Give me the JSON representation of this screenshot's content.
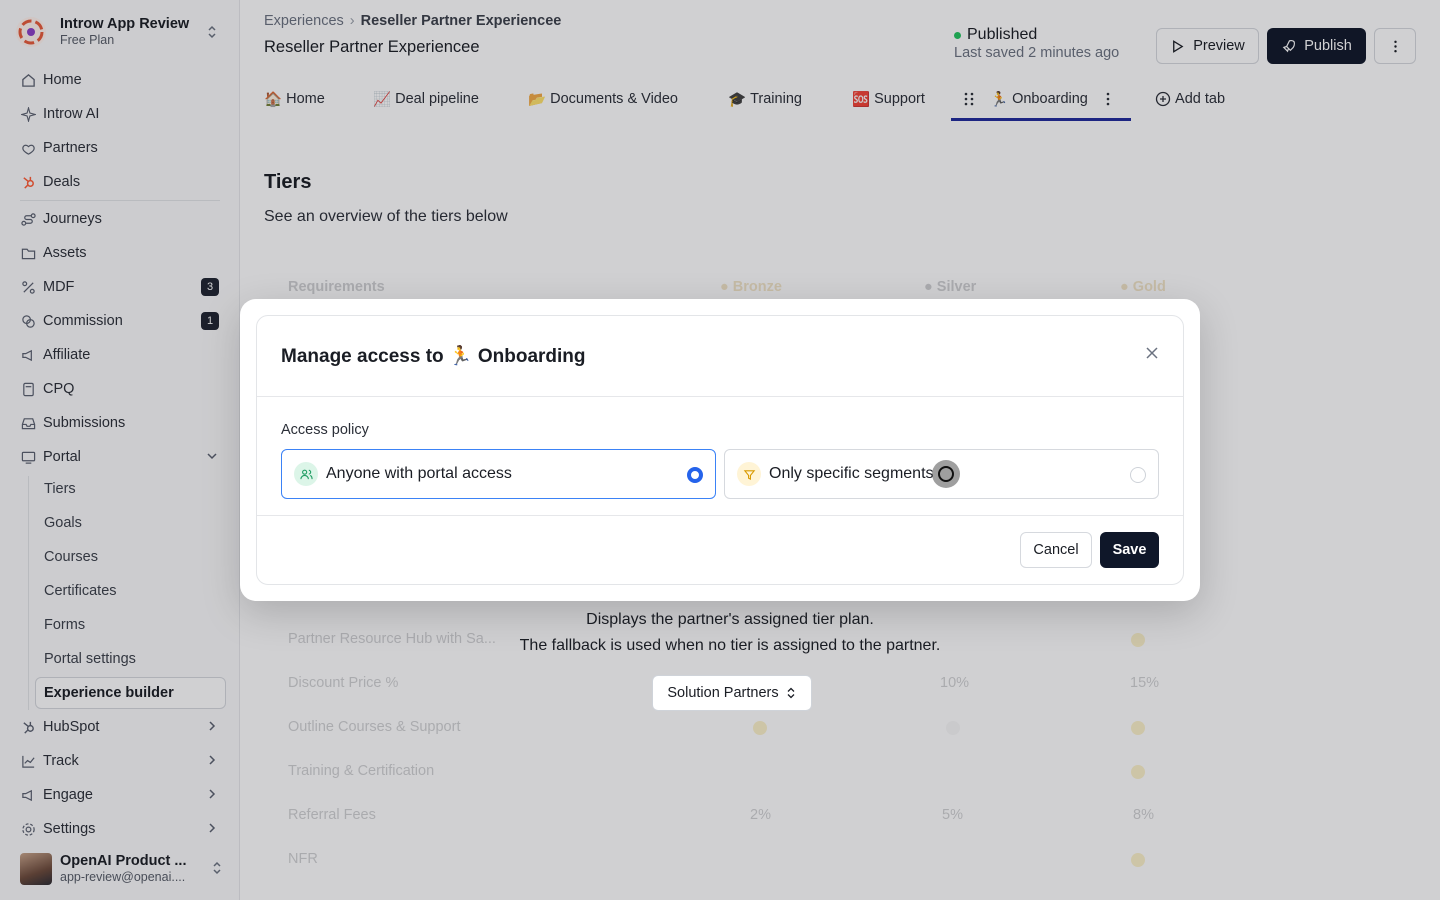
{
  "workspace": {
    "name": "Introw App Review",
    "plan": "Free Plan"
  },
  "sidebar": {
    "items": [
      {
        "label": "Home",
        "icon": "home-icon"
      },
      {
        "label": "Introw AI",
        "icon": "sparkle-icon"
      },
      {
        "label": "Partners",
        "icon": "handshake-icon"
      },
      {
        "label": "Deals",
        "icon": "hubspot-icon"
      },
      {
        "label": "Journeys",
        "icon": "route-icon"
      },
      {
        "label": "Assets",
        "icon": "folder-icon"
      },
      {
        "label": "MDF",
        "icon": "percent-icon",
        "badge": "3"
      },
      {
        "label": "Commission",
        "icon": "coins-icon",
        "badge": "1"
      },
      {
        "label": "Affiliate",
        "icon": "megaphone-icon"
      },
      {
        "label": "CPQ",
        "icon": "calculator-icon"
      },
      {
        "label": "Submissions",
        "icon": "inbox-icon"
      },
      {
        "label": "Portal",
        "icon": "monitor-icon"
      }
    ],
    "portal_sub": [
      "Tiers",
      "Goals",
      "Courses",
      "Certificates",
      "Forms",
      "Portal settings"
    ],
    "portal_active": "Experience builder",
    "bottom_items": [
      {
        "label": "HubSpot",
        "icon": "hubspot-icon"
      },
      {
        "label": "Track",
        "icon": "chart-icon"
      },
      {
        "label": "Engage",
        "icon": "megaphone-icon"
      },
      {
        "label": "Settings",
        "icon": "gear-icon"
      }
    ]
  },
  "user": {
    "name": "OpenAI Product ...",
    "email": "app-review@openai...."
  },
  "header": {
    "breadcrumb_root": "Experiences",
    "breadcrumb_current": "Reseller Partner Experiencee",
    "title": "Reseller Partner Experiencee",
    "status": "Published",
    "saved": "Last saved 2 minutes ago",
    "preview": "Preview",
    "publish": "Publish"
  },
  "tabs": [
    {
      "emoji": "🏠",
      "label": "Home"
    },
    {
      "emoji": "📈",
      "label": "Deal pipeline"
    },
    {
      "emoji": "📂",
      "label": "Documents & Video"
    },
    {
      "emoji": "🎓",
      "label": "Training"
    },
    {
      "emoji": "🆘",
      "label": "Support"
    },
    {
      "emoji": "🏃",
      "label": "Onboarding"
    }
  ],
  "add_tab": "Add tab",
  "section": {
    "title": "Tiers",
    "subtitle": "See an overview of the tiers below"
  },
  "table": {
    "headers": [
      "Requirements",
      "Bronze",
      "Silver",
      "Gold"
    ],
    "rows": [
      {
        "label": "Partner Resource Hub with Sa...",
        "cells": [
          "",
          "",
          ""
        ]
      },
      {
        "label": "Discount Price %",
        "cells": [
          "",
          "10%",
          "15%"
        ]
      },
      {
        "label": "Outline Courses & Support",
        "cells": [
          "",
          "",
          ""
        ]
      },
      {
        "label": "Training & Certification",
        "cells": [
          "",
          "",
          ""
        ]
      },
      {
        "label": "Referral Fees",
        "cells": [
          "2%",
          "5%",
          "8%"
        ]
      },
      {
        "label": "NFR",
        "cells": [
          "",
          "",
          ""
        ]
      }
    ]
  },
  "tier_info": {
    "line1": "Displays the partner's assigned tier plan.",
    "line2": "The fallback is used when no tier is assigned to the partner.",
    "select": "Solution Partners"
  },
  "modal": {
    "title": "Manage access to 🏃 Onboarding",
    "access_label": "Access policy",
    "option1": "Anyone with portal access",
    "option2": "Only specific segments",
    "cancel": "Cancel",
    "save": "Save"
  }
}
